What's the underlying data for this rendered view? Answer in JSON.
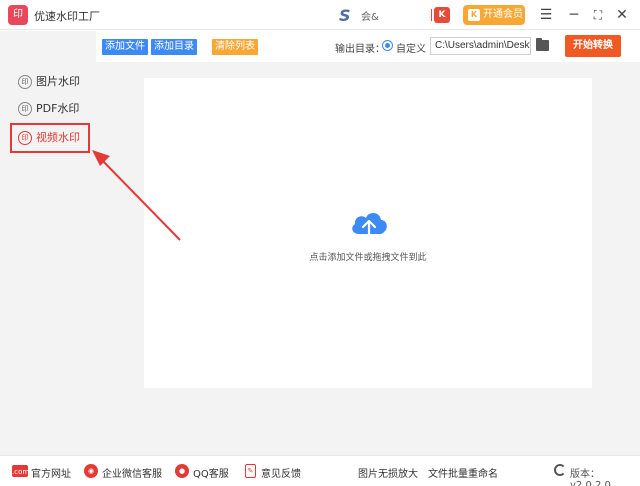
{
  "app": {
    "title": "优速水印工厂",
    "logo_text": "印"
  },
  "titlebar": {
    "brand_text": "会&",
    "vip_label": "开通会员"
  },
  "sidebar": {
    "items": [
      {
        "label": "图片水印",
        "icon_text": "印"
      },
      {
        "label": "PDF水印",
        "icon_text": "印"
      },
      {
        "label": "视频水印",
        "icon_text": "印"
      }
    ]
  },
  "toolbar": {
    "add_file": "添加文件",
    "add_dir": "添加目录",
    "clear_list": "清除列表",
    "output_label": "输出目录：",
    "custom_option": "自定义",
    "output_path": "C:\\Users\\admin\\Deskto",
    "start_button": "开始转换"
  },
  "dropzone": {
    "hint": "点击添加文件或拖拽文件到此"
  },
  "footer": {
    "official_site": "官方网址",
    "wechat_service": "企业微信客服",
    "qq_service": "QQ客服",
    "feedback": "意见反馈",
    "image_upscale": "图片无损放大",
    "batch_rename": "文件批量重命名",
    "version": "版本：v2.0.2.0"
  },
  "colors": {
    "accent_blue": "#3d8af7",
    "accent_orange": "#f7a734",
    "start_orange": "#f05a22",
    "highlight_red": "#e53935"
  }
}
